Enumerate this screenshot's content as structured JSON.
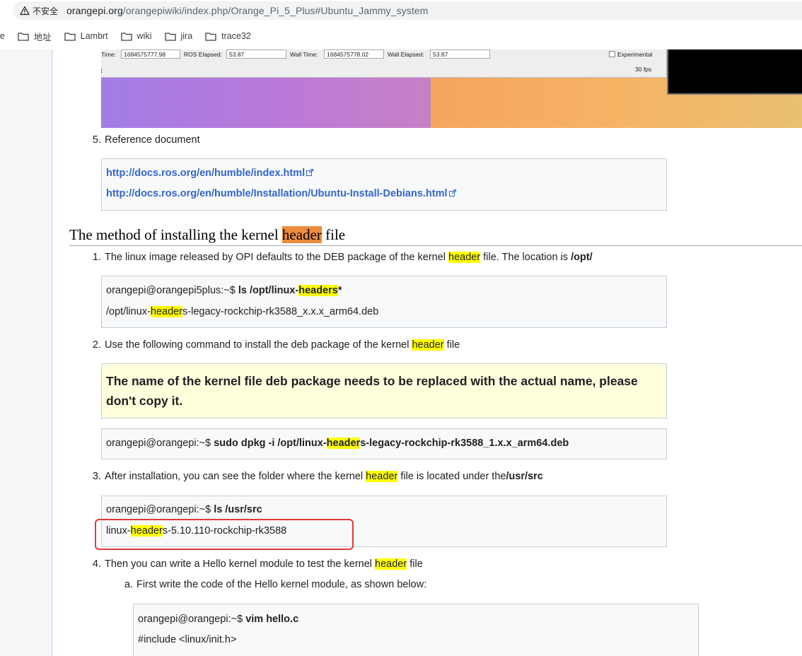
{
  "browser": {
    "warning_label": "不安全",
    "url_host": "orangepi.org",
    "url_path": "/orangepiwiki/index.php/Orange_Pi_5_Plus#Ubuntu_Jammy_system",
    "bookmarks": [
      {
        "label": "ie"
      },
      {
        "label": "地址"
      },
      {
        "label": "Lambrt"
      },
      {
        "label": "wiki"
      },
      {
        "label": "jira"
      },
      {
        "label": "trace32"
      }
    ]
  },
  "ros_panel": {
    "time_label": "Time:",
    "time_value": "1684575777.98",
    "ros_elapsed_label": "ROS Elapsed:",
    "ros_elapsed_value": "53.87",
    "wall_time_label": "Wall Time:",
    "wall_time_value": "1684575778.02",
    "wall_elapsed_label": "Wall Elapsed:",
    "wall_elapsed_value": "53.87",
    "experimental_label": "Experimental",
    "fps": "30 fps",
    "left_fragment": "t"
  },
  "reference": {
    "item_num": "5.",
    "item_text": "Reference document",
    "links": [
      "http://docs.ros.org/en/humble/index.html",
      "http://docs.ros.org/en/humble/Installation/Ubuntu-Install-Debians.html"
    ]
  },
  "section": {
    "heading_pre": "The method of installing the kernel ",
    "heading_hl": "header",
    "heading_post": " file",
    "step1": {
      "num": "1.",
      "pre": "The linux image released by OPI defaults to the DEB package of the kernel ",
      "hl": "header",
      "mid": " file. The location is ",
      "bold": "/opt/",
      "code1_prompt": "orangepi@orangepi5plus:~$ ",
      "code1_cmd_a": "ls /opt/linux-",
      "code1_cmd_hl": "headers",
      "code1_cmd_b": "*",
      "code2_a": "/opt/linux-",
      "code2_hl": "header",
      "code2_b": "s-legacy-rockchip-rk3588_x.x.x_arm64.deb"
    },
    "step2": {
      "num": "2.",
      "pre": "Use the following command to install the deb package of the kernel ",
      "hl": "header",
      "post": " file",
      "warning_line1": "The name of the kernel file deb package needs to be replaced with the actual name, please",
      "warning_line2": "don't copy it.",
      "code_prompt": "orangepi@orangepi:~$ ",
      "code_cmd_a": "sudo dpkg -i /opt/linux-",
      "code_cmd_hl": "header",
      "code_cmd_b": "s-legacy-rockchip-rk3588_1.x.x_arm64.deb"
    },
    "step3": {
      "num": "3.",
      "pre": "After installation, you can see the folder where the kernel ",
      "hl": "header",
      "mid": " file is located under the",
      "bold": "/usr/src",
      "code_prompt": "orangepi@orangepi:~$ ",
      "code_cmd": "ls /usr/src",
      "out_a": "linux-",
      "out_hl": "header",
      "out_b": "s-5.10.110-rockchip-rk3588"
    },
    "step4": {
      "num": "4.",
      "pre": "Then you can write a Hello kernel module to test the kernel ",
      "hl": "header",
      "post": " file",
      "sub_num": "a.",
      "sub_text": "First write the code of the Hello kernel module, as shown below:",
      "code_prompt": "orangepi@orangepi:~$ ",
      "code_cmd": "vim hello.c",
      "code_line2": "#include <linux/init.h>"
    }
  }
}
